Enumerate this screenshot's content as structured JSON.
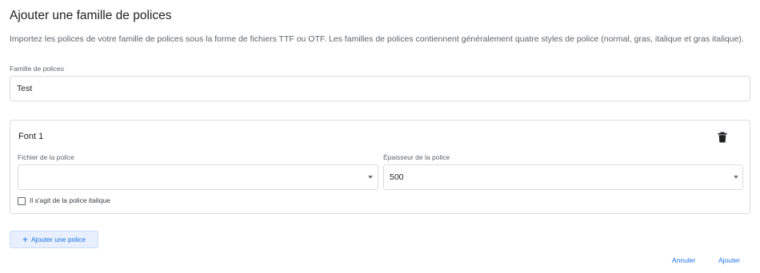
{
  "dialog": {
    "title": "Ajouter une famille de polices",
    "description": "Importez les polices de votre famille de polices sous la forme de fichiers TTF ou OTF. Les familles de polices contiennent généralement quatre styles de police (normal, gras, italique et gras italique)."
  },
  "family": {
    "label": "Famille de polices",
    "value": "Test"
  },
  "font_card": {
    "title": "Font 1",
    "delete_icon": "trash-icon",
    "file_label": "Fichier de la police",
    "file_value": "",
    "weight_label": "Épaisseur de la police",
    "weight_value": "500",
    "italic_label": "Il s'agit de la police italique",
    "italic_checked": false
  },
  "actions": {
    "add_font_label": "Ajouter une police",
    "add_font_icon": "plus-icon",
    "cancel_label": "Annuler",
    "submit_label": "Ajouter"
  },
  "colors": {
    "accent": "#1a73e8",
    "accent_bg": "#e8f0fe",
    "border": "#dadce0"
  }
}
